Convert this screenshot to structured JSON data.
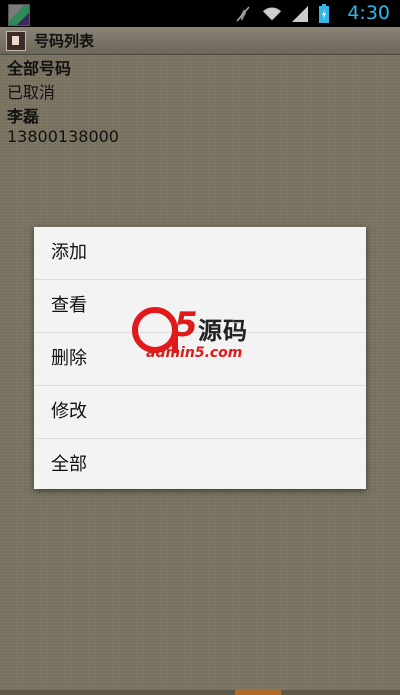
{
  "status_bar": {
    "time": "4:30",
    "icons": [
      "app-icon",
      "mute-icon",
      "wifi-icon",
      "signal-icon",
      "battery-icon"
    ],
    "accent_color": "#33b5e5"
  },
  "title_bar": {
    "title": "号码列表"
  },
  "list": {
    "header": "全部号码",
    "status": "已取消",
    "name": "李磊",
    "number": "13800138000"
  },
  "context_menu": {
    "items": [
      "添加",
      "查看",
      "删除",
      "修改",
      "全部"
    ]
  },
  "watermark": {
    "a_letter": "a",
    "digit": "5",
    "chinese": "源码",
    "url": "admin5.com",
    "color": "#e01a1a"
  }
}
